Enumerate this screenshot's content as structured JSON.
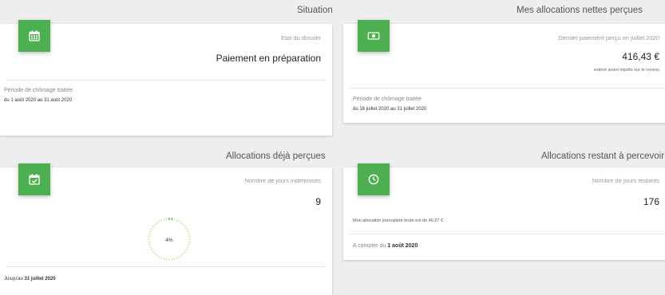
{
  "sections": {
    "situation": "Situation",
    "allocations_nettes": "Mes allocations nettes perçues",
    "deja_percues": "Allocations déjà perçues",
    "restant": "Allocations restant à percevoir"
  },
  "situation_card": {
    "icon": "calendar-icon",
    "label": "Etat du dossier",
    "value": "Paiement en préparation",
    "footer_label": "Période de chômage traitée",
    "footer_value": "du 1 août 2020 au 31 août 2020"
  },
  "allocations_card": {
    "icon": "money-icon",
    "label": "Dernier paiement perçu en juillet 2020",
    "value": "416,43 €",
    "note": "estimé avant impôts sur le revenu",
    "footer_label": "Période de chômage traitée",
    "footer_value": "du 16 juillet 2020 au 31 juillet 2020"
  },
  "deja_card": {
    "icon": "calendar-check-icon",
    "label": "Nombre de jours indemnisés",
    "value": "9",
    "progress_text": "4%",
    "progress_fraction": 0.04,
    "footer_prefix": "Jusqu'au",
    "footer_date": "31 juillet 2020"
  },
  "restant_card": {
    "icon": "clock-icon",
    "label": "Nombre de jours restants",
    "value": "176",
    "note": "Mon allocation journalière brute est de 46,27 €",
    "footer_prefix": "A compter du",
    "footer_date": "1 août 2020"
  },
  "colors": {
    "accent": "#4caf50",
    "background": "#eeeeee"
  }
}
